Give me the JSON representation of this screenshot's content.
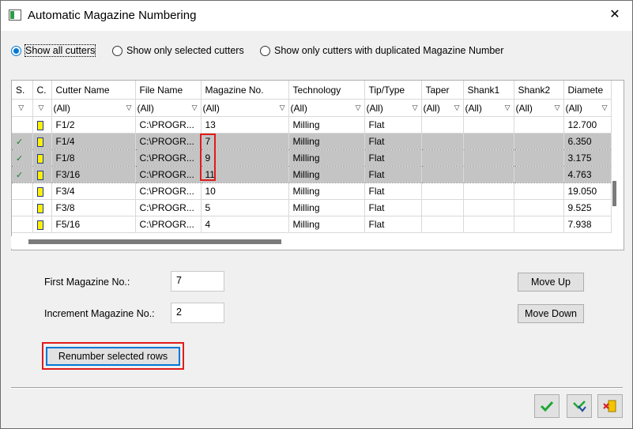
{
  "window": {
    "title": "Automatic Magazine Numbering",
    "close_icon": "close-icon"
  },
  "filter_options": {
    "show_all": "Show all cutters",
    "show_selected": "Show only selected cutters",
    "show_duplicated": "Show only cutters with duplicated Magazine Number",
    "selected": "show_all"
  },
  "table": {
    "columns": [
      "S.",
      "C.",
      "Cutter Name",
      "File Name",
      "Magazine No.",
      "Technology",
      "Tip/Type",
      "Taper",
      "Shank1",
      "Shank2",
      "Diamete"
    ],
    "filter_value": "(All)",
    "rows": [
      {
        "selected": false,
        "name": "F1/2",
        "file": "C:\\PROGR...",
        "mag": "13",
        "tech": "Milling",
        "tip": "Flat",
        "taper": "",
        "shank1": "",
        "shank2": "",
        "diameter": "12.700"
      },
      {
        "selected": true,
        "name": "F1/4",
        "file": "C:\\PROGR...",
        "mag": "7",
        "tech": "Milling",
        "tip": "Flat",
        "taper": "",
        "shank1": "",
        "shank2": "",
        "diameter": "6.350"
      },
      {
        "selected": true,
        "name": "F1/8",
        "file": "C:\\PROGR...",
        "mag": "9",
        "tech": "Milling",
        "tip": "Flat",
        "taper": "",
        "shank1": "",
        "shank2": "",
        "diameter": "3.175"
      },
      {
        "selected": true,
        "name": "F3/16",
        "file": "C:\\PROGR...",
        "mag": "11",
        "tech": "Milling",
        "tip": "Flat",
        "taper": "",
        "shank1": "",
        "shank2": "",
        "diameter": "4.763"
      },
      {
        "selected": false,
        "name": "F3/4",
        "file": "C:\\PROGR...",
        "mag": "10",
        "tech": "Milling",
        "tip": "Flat",
        "taper": "",
        "shank1": "",
        "shank2": "",
        "diameter": "19.050"
      },
      {
        "selected": false,
        "name": "F3/8",
        "file": "C:\\PROGR...",
        "mag": "5",
        "tech": "Milling",
        "tip": "Flat",
        "taper": "",
        "shank1": "",
        "shank2": "",
        "diameter": "9.525"
      },
      {
        "selected": false,
        "name": "F5/16",
        "file": "C:\\PROGR...",
        "mag": "4",
        "tech": "Milling",
        "tip": "Flat",
        "taper": "",
        "shank1": "",
        "shank2": "",
        "diameter": "7.938"
      }
    ]
  },
  "form": {
    "first_label": "First Magazine No.:",
    "first_value": "7",
    "increment_label": "Increment Magazine No.:",
    "increment_value": "2",
    "renumber_button": "Renumber selected rows",
    "move_up_button": "Move Up",
    "move_down_button": "Move Down"
  },
  "footer_icons": [
    "ok-check-icon",
    "apply-check-icon",
    "cancel-exit-icon"
  ],
  "colors": {
    "accent": "#0078d7",
    "highlight": "#e01b1b",
    "selected_row": "#c4c4c4"
  }
}
